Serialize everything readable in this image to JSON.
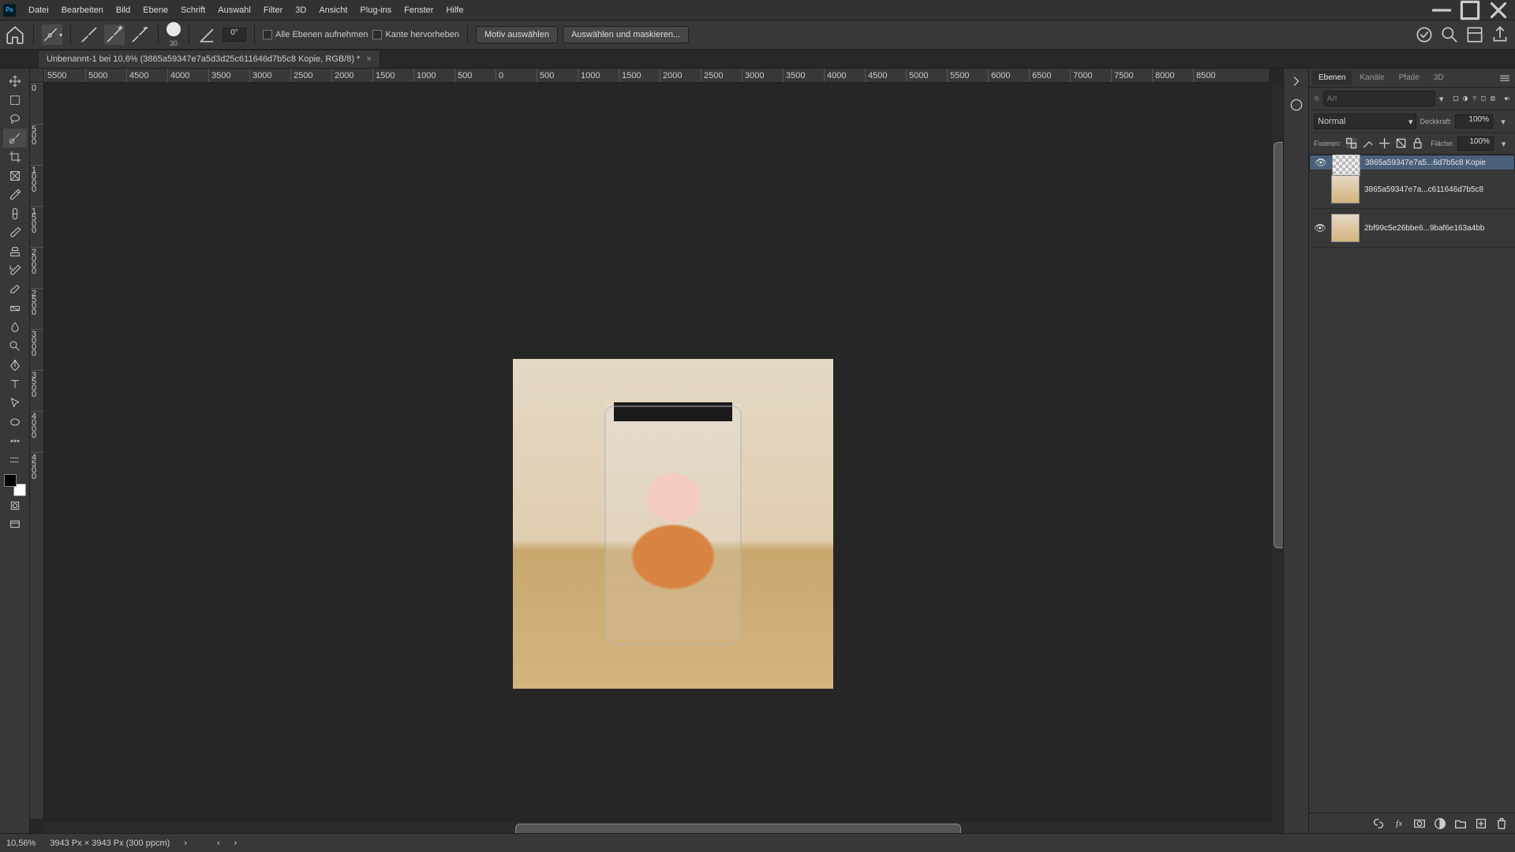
{
  "menu": [
    "Datei",
    "Bearbeiten",
    "Bild",
    "Ebene",
    "Schrift",
    "Auswahl",
    "Filter",
    "3D",
    "Ansicht",
    "Plug-ins",
    "Fenster",
    "Hilfe"
  ],
  "options": {
    "brush_size": "30",
    "angle": "0°",
    "chk_all_layers": "Alle Ebenen aufnehmen",
    "chk_edge": "Kante hervorheben",
    "btn_subject": "Motiv auswählen",
    "btn_mask": "Auswählen und maskieren..."
  },
  "doc_tab": "Unbenannt-1 bei 10,6% (3865a59347e7a5d3d25c611646d7b5c8 Kopie, RGB/8) *",
  "ruler_h": [
    "5500",
    "5000",
    "4500",
    "4000",
    "3500",
    "3000",
    "2500",
    "2000",
    "1500",
    "1000",
    "500",
    "0",
    "500",
    "1000",
    "1500",
    "2000",
    "2500",
    "3000",
    "3500",
    "4000",
    "4500",
    "5000",
    "5500",
    "6000",
    "6500",
    "7000",
    "7500",
    "8000",
    "8500"
  ],
  "ruler_v": [
    "0",
    "0",
    "5",
    "0",
    "0",
    "1",
    "0",
    "0",
    "0",
    "1",
    "5",
    "0",
    "0",
    "2",
    "0",
    "0",
    "0",
    "2",
    "5",
    "0",
    "0",
    "3",
    "0",
    "0",
    "0",
    "3",
    "5",
    "0",
    "0",
    "4",
    "0",
    "0",
    "0",
    "4",
    "5",
    "0",
    "0"
  ],
  "panel": {
    "tabs": [
      "Ebenen",
      "Kanäle",
      "Pfade",
      "3D"
    ],
    "search_placeholder": "Art",
    "blend": "Normal",
    "opacity_lbl": "Deckkraft:",
    "opacity_val": "100%",
    "lock_lbl": "Fixieren:",
    "fill_lbl": "Fläche:",
    "fill_val": "100%"
  },
  "layers": [
    {
      "vis": "●",
      "name": "3865a59347e7a5...6d7b5c8 Kopie",
      "sel": true,
      "trans": true
    },
    {
      "vis": "",
      "name": "3865a59347e7a...c611646d7b5c8",
      "sel": false,
      "trans": false
    },
    {
      "vis": "●",
      "name": "2bf99c5e26bbe6...9baf6e163a4bb",
      "sel": false,
      "trans": false
    }
  ],
  "status": {
    "zoom": "10,56%",
    "dims": "3943 Px × 3943 Px (300 ppcm)"
  }
}
